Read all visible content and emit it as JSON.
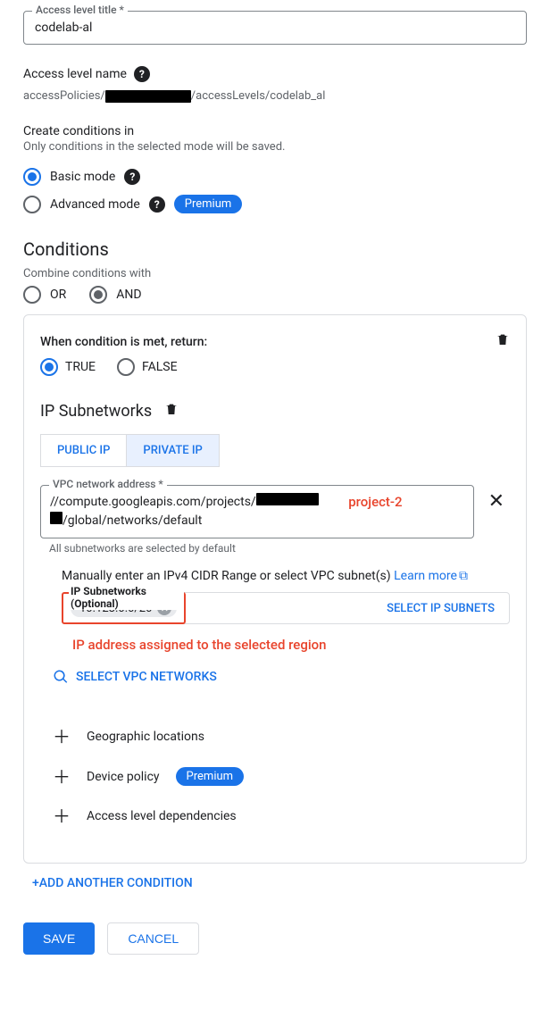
{
  "accessLevelTitle": {
    "label": "Access level title *",
    "value": "codelab-al"
  },
  "accessLevelName": {
    "label": "Access level name",
    "path_prefix": "accessPolicies/",
    "path_mid": "/accessLevels/",
    "path_suffix": "codelab_al"
  },
  "createConditions": {
    "title": "Create conditions in",
    "subtitle": "Only conditions in the selected mode will be saved."
  },
  "modes": {
    "basic": "Basic mode",
    "advanced": "Advanced mode",
    "premium": "Premium"
  },
  "conditions": {
    "heading": "Conditions",
    "combine_label": "Combine conditions with",
    "or": "OR",
    "and": "AND"
  },
  "conditionCard": {
    "when_met": "When condition is met, return:",
    "true": "TRUE",
    "false": "FALSE",
    "ip_subnetworks_heading": "IP Subnetworks",
    "tabs": {
      "public": "PUBLIC IP",
      "private": "PRIVATE IP"
    },
    "vpc": {
      "label": "VPC network address *",
      "value_line1": "//compute.googleapis.com/projects/",
      "value_line2": "/global/networks/default",
      "hint": "All subnetworks are selected by default"
    },
    "manual_text": "Manually enter an IPv4 CIDR Range or select VPC subnet(s) ",
    "learn_more": "Learn more",
    "ip_sub_label": "IP Subnetworks (Optional)",
    "ip_chip": "10.128.0.0/20",
    "select_subnets": "SELECT IP SUBNETS",
    "select_vpc": "SELECT VPC NETWORKS",
    "add_items": {
      "geo": "Geographic locations",
      "device": "Device policy",
      "deps": "Access level dependencies"
    }
  },
  "annotations": {
    "project2": "project-2",
    "ip_assigned": "IP address assigned to the selected region"
  },
  "addAnother": "+ADD ANOTHER CONDITION",
  "footer": {
    "save": "SAVE",
    "cancel": "CANCEL"
  }
}
